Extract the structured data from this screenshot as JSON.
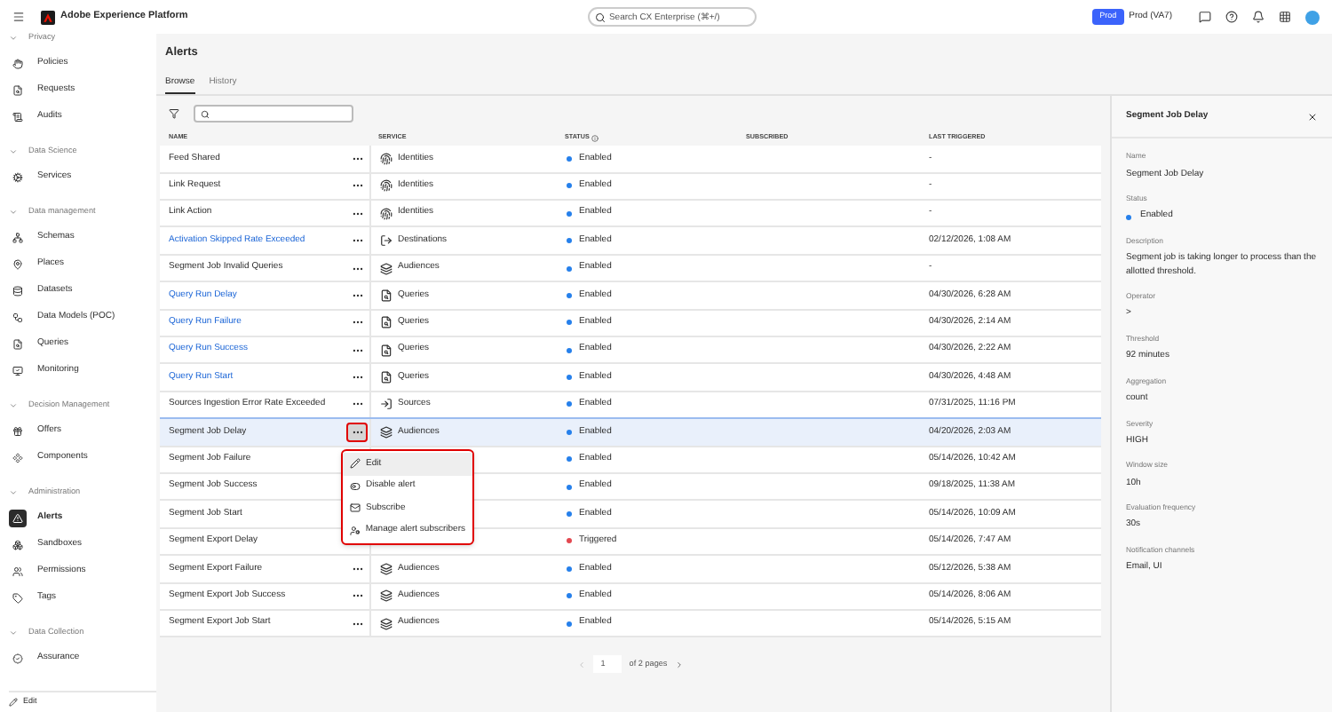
{
  "header": {
    "product": "Adobe Experience Platform",
    "search": {
      "placeholder": "Search CX Enterprise (⌘+/)"
    },
    "env_badge": "Prod",
    "sandbox": "Prod (VA7)"
  },
  "sidebar": {
    "groups": [
      {
        "label": "Privacy",
        "expanded": true,
        "children": [
          {
            "label": "Policies",
            "selected": false
          },
          {
            "label": "Requests",
            "selected": false
          },
          {
            "label": "Audits",
            "selected": false
          }
        ]
      },
      {
        "label": "Data Science",
        "expanded": true,
        "children": [
          {
            "label": "Services",
            "selected": false
          }
        ]
      },
      {
        "label": "Data management",
        "expanded": true,
        "children": [
          {
            "label": "Schemas",
            "selected": false
          },
          {
            "label": "Places",
            "selected": false
          },
          {
            "label": "Datasets",
            "selected": false
          },
          {
            "label": "Data Models (POC)",
            "selected": false
          },
          {
            "label": "Queries",
            "selected": false
          },
          {
            "label": "Monitoring",
            "selected": false
          }
        ]
      },
      {
        "label": "Decision Management",
        "expanded": true,
        "children": [
          {
            "label": "Offers",
            "selected": false
          },
          {
            "label": "Components",
            "selected": false
          }
        ]
      },
      {
        "label": "Administration",
        "expanded": true,
        "children": [
          {
            "label": "Alerts",
            "selected": true
          },
          {
            "label": "Sandboxes",
            "selected": false
          },
          {
            "label": "Permissions",
            "selected": false
          },
          {
            "label": "Tags",
            "selected": false
          }
        ]
      },
      {
        "label": "Data Collection",
        "expanded": true,
        "children": [
          {
            "label": "Assurance",
            "selected": false
          }
        ]
      }
    ],
    "edit": "Edit"
  },
  "page": {
    "title": "Alerts",
    "tabs": [
      {
        "label": "Browse",
        "selected": true
      },
      {
        "label": "History",
        "selected": false
      }
    ]
  },
  "table": {
    "columns": [
      "NAME",
      "SERVICE",
      "STATUS",
      "SUBSCRIBED",
      "LAST TRIGGERED"
    ],
    "rows": [
      {
        "name": "Feed Shared",
        "link": false,
        "selected": false,
        "service": {
          "kind": "identity",
          "label": "Identities"
        },
        "status": {
          "label": "Enabled",
          "color": "#2680eb"
        },
        "last": "-"
      },
      {
        "name": "Link Request",
        "link": false,
        "selected": false,
        "service": {
          "kind": "identity",
          "label": "Identities"
        },
        "status": {
          "label": "Enabled",
          "color": "#2680eb"
        },
        "last": "-"
      },
      {
        "name": "Link Action",
        "link": false,
        "selected": false,
        "service": {
          "kind": "identity",
          "label": "Identities"
        },
        "status": {
          "label": "Enabled",
          "color": "#2680eb"
        },
        "last": "-"
      },
      {
        "name": "Activation Skipped Rate Exceeded",
        "link": true,
        "selected": false,
        "service": {
          "kind": "destination",
          "label": "Destinations"
        },
        "status": {
          "label": "Enabled",
          "color": "#2680eb"
        },
        "last": "02/12/2026, 1:08 AM"
      },
      {
        "name": "Segment Job Invalid Queries",
        "link": false,
        "selected": false,
        "service": {
          "kind": "audience",
          "label": "Audiences"
        },
        "status": {
          "label": "Enabled",
          "color": "#2680eb"
        },
        "last": "-"
      },
      {
        "name": "Query Run Delay",
        "link": true,
        "selected": false,
        "service": {
          "kind": "query",
          "label": "Queries"
        },
        "status": {
          "label": "Enabled",
          "color": "#2680eb"
        },
        "last": "04/30/2026, 6:28 AM"
      },
      {
        "name": "Query Run Failure",
        "link": true,
        "selected": false,
        "service": {
          "kind": "query",
          "label": "Queries"
        },
        "status": {
          "label": "Enabled",
          "color": "#2680eb"
        },
        "last": "04/30/2026, 2:14 AM"
      },
      {
        "name": "Query Run Success",
        "link": true,
        "selected": false,
        "service": {
          "kind": "query",
          "label": "Queries"
        },
        "status": {
          "label": "Enabled",
          "color": "#2680eb"
        },
        "last": "04/30/2026, 2:22 AM"
      },
      {
        "name": "Query Run Start",
        "link": true,
        "selected": false,
        "service": {
          "kind": "query",
          "label": "Queries"
        },
        "status": {
          "label": "Enabled",
          "color": "#2680eb"
        },
        "last": "04/30/2026, 4:48 AM"
      },
      {
        "name": "Sources Ingestion Error Rate Exceeded",
        "link": false,
        "selected": false,
        "service": {
          "kind": "source",
          "label": "Sources"
        },
        "status": {
          "label": "Enabled",
          "color": "#2680eb"
        },
        "last": "07/31/2025, 11:16 PM"
      },
      {
        "name": "Segment Job Delay",
        "link": false,
        "selected": true,
        "service": {
          "kind": "audience",
          "label": "Audiences"
        },
        "status": {
          "label": "Enabled",
          "color": "#2680eb"
        },
        "last": "04/20/2026, 2:03 AM"
      },
      {
        "name": "Segment Job Failure",
        "link": false,
        "selected": false,
        "status": {
          "label": "Enabled",
          "color": "#2680eb"
        },
        "last": "05/14/2026, 10:42 AM"
      },
      {
        "name": "Segment Job Success",
        "link": false,
        "selected": false,
        "status": {
          "label": "Enabled",
          "color": "#2680eb"
        },
        "last": "09/18/2025, 11:38 AM"
      },
      {
        "name": "Segment Job Start",
        "link": false,
        "selected": false,
        "status": {
          "label": "Enabled",
          "color": "#2680eb"
        },
        "last": "05/14/2026, 10:09 AM"
      },
      {
        "name": "Segment Export Delay",
        "link": false,
        "selected": false,
        "status": {
          "label": "Triggered",
          "color": "#e34850"
        },
        "last": "05/14/2026, 7:47 AM"
      },
      {
        "name": "Segment Export Failure",
        "link": false,
        "selected": false,
        "service": {
          "kind": "audience",
          "label": "Audiences"
        },
        "status": {
          "label": "Enabled",
          "color": "#2680eb"
        },
        "last": "05/12/2026, 5:38 AM"
      },
      {
        "name": "Segment Export Job Success",
        "link": false,
        "selected": false,
        "service": {
          "kind": "audience",
          "label": "Audiences"
        },
        "status": {
          "label": "Enabled",
          "color": "#2680eb"
        },
        "last": "05/14/2026, 8:06 AM"
      },
      {
        "name": "Segment Export Job Start",
        "link": false,
        "selected": false,
        "service": {
          "kind": "audience",
          "label": "Audiences"
        },
        "status": {
          "label": "Enabled",
          "color": "#2680eb"
        },
        "last": "05/14/2026, 5:15 AM"
      }
    ],
    "menu": [
      {
        "kind": "edit",
        "label": "Edit",
        "selected": true
      },
      {
        "kind": "disable",
        "label": "Disable alert",
        "selected": false
      },
      {
        "kind": "subscribe",
        "label": "Subscribe",
        "selected": false
      },
      {
        "kind": "manage",
        "label": "Manage alert subscribers",
        "selected": false
      }
    ]
  },
  "pagination": {
    "page": "1",
    "of": "of 2 pages"
  },
  "detail": {
    "title": "Segment Job Delay",
    "fields": [
      {
        "label": "Name",
        "value": "Segment Job Delay"
      },
      {
        "label": "Status",
        "value": "Enabled",
        "color": "#2680eb"
      },
      {
        "label": "Description",
        "value": "Segment job is taking longer to process than the allotted threshold."
      },
      {
        "label": "Operator",
        "value": ">"
      },
      {
        "label": "Threshold",
        "value": "92 minutes"
      },
      {
        "label": "Aggregation",
        "value": "count"
      },
      {
        "label": "Severity",
        "value": "HIGH"
      },
      {
        "label": "Window size",
        "value": "10h"
      },
      {
        "label": "Evaluation frequency",
        "value": "30s"
      },
      {
        "label": "Notification channels",
        "value": "Email, UI"
      }
    ]
  }
}
